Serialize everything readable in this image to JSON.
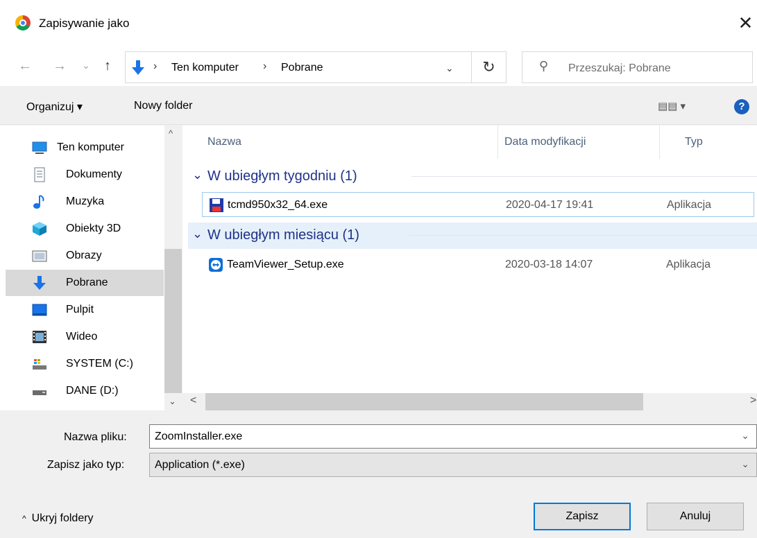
{
  "window": {
    "title": "Zapisywanie jako",
    "close": "✕"
  },
  "nav": {
    "back": "←",
    "forward": "→",
    "recent": "⌄",
    "up": "↑",
    "breadcrumb": [
      "Ten komputer",
      "Pobrane"
    ],
    "separator": "›",
    "dropdown": "⌄",
    "refresh": "↻",
    "search_placeholder": "Przeszukaj: Pobrane"
  },
  "toolbar": {
    "organize": "Organizuj ▾",
    "new_folder": "Nowy folder",
    "view": "▤▤ ▾",
    "help": "?"
  },
  "sidebar": {
    "items": [
      {
        "label": "Ten komputer",
        "icon": "computer-icon"
      },
      {
        "label": "Dokumenty",
        "icon": "document-icon"
      },
      {
        "label": "Muzyka",
        "icon": "music-icon"
      },
      {
        "label": "Obiekty 3D",
        "icon": "cube-3d-icon"
      },
      {
        "label": "Obrazy",
        "icon": "pictures-icon"
      },
      {
        "label": "Pobrane",
        "icon": "download-icon"
      },
      {
        "label": "Pulpit",
        "icon": "desktop-icon"
      },
      {
        "label": "Wideo",
        "icon": "video-icon"
      },
      {
        "label": "SYSTEM (C:)",
        "icon": "system-drive-icon"
      },
      {
        "label": "DANE (D:)",
        "icon": "drive-icon"
      }
    ],
    "selected": "Pobrane",
    "scroll_up": "^",
    "scroll_down": "⌄"
  },
  "files": {
    "columns": {
      "name": "Nazwa",
      "date": "Data modyfikacji",
      "type": "Typ"
    },
    "groups": [
      {
        "label": "W ubiegłym tygodniu (1)",
        "files": [
          {
            "name": "tcmd950x32_64.exe",
            "date": "2020-04-17 19:41",
            "type": "Aplikacja",
            "icon": "floppy-app-icon"
          }
        ]
      },
      {
        "label": "W ubiegłym miesiącu (1)",
        "files": [
          {
            "name": "TeamViewer_Setup.exe",
            "date": "2020-03-18 14:07",
            "type": "Aplikacja",
            "icon": "teamviewer-icon"
          }
        ]
      }
    ],
    "scroll_left": "<",
    "scroll_right": ">"
  },
  "form": {
    "filename_label": "Nazwa pliku:",
    "filename_value": "ZoomInstaller.exe",
    "type_label": "Zapisz jako typ:",
    "type_value": "Application (*.exe)",
    "dropdown_arrow": "⌄"
  },
  "footer": {
    "hide_folders": "Ukryj foldery",
    "hide_caret": "^",
    "save": "Zapisz",
    "cancel": "Anuluj"
  },
  "colors": {
    "accent": "#0078d7",
    "group_text": "#1e3287",
    "selected_bg": "#d9d9d9",
    "group_hl": "#e6f0fa"
  }
}
